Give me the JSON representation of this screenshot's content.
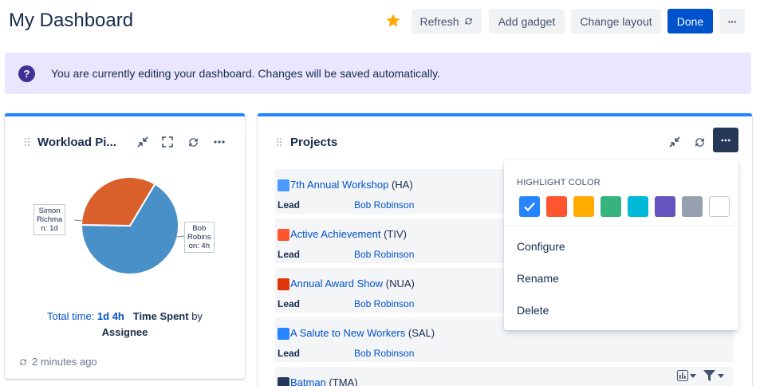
{
  "header": {
    "title": "My Dashboard",
    "refresh_label": "Refresh",
    "add_gadget_label": "Add gadget",
    "change_layout_label": "Change layout",
    "done_label": "Done",
    "more_label": "···",
    "star_icon": "star-icon",
    "star_color": "#ffab00"
  },
  "banner": {
    "text": "You are currently editing your dashboard. Changes will be saved automatically.",
    "icon": "question-icon"
  },
  "workload": {
    "title": "Workload Pi...",
    "chart_data": {
      "type": "pie",
      "slices": [
        {
          "label": "Simon Richman: 1d",
          "value": 1,
          "color": "#4a90c8"
        },
        {
          "label": "Bob Robinson: 4h",
          "value": 0.5,
          "color": "#d95f2b"
        }
      ]
    },
    "label_simon": [
      "Simon",
      "Richma",
      "n: 1d"
    ],
    "label_bob": [
      "Bob",
      "Robins",
      "on: 4h"
    ],
    "total_label": "Total time:",
    "total_value": "1d 4h",
    "time_spent": "Time Spent",
    "by": "by",
    "assignee": "Assignee",
    "updated": "2 minutes ago"
  },
  "projects": {
    "title": "Projects",
    "lead_label": "Lead",
    "rows": [
      {
        "name": "7th Annual Workshop",
        "key": "(HA)",
        "lead": "Bob Robinson",
        "icon_color": "#4c9aff"
      },
      {
        "name": "Active Achievement",
        "key": "(TIV)",
        "lead": "Bob Robinson",
        "icon_color": "#ff5630"
      },
      {
        "name": "Annual Award Show",
        "key": "(NUA)",
        "lead": "Bob Robinson",
        "icon_color": "#de350b"
      },
      {
        "name": "A Salute to New Workers",
        "key": "(SAL)",
        "lead": "Bob Robinson",
        "icon_color": "#2684ff"
      },
      {
        "name": "Batman",
        "key": "(TMA)",
        "lead": "",
        "icon_color": "#253858"
      }
    ]
  },
  "dropdown": {
    "heading": "HIGHLIGHT COLOR",
    "colors": [
      "#2684ff",
      "#ff5630",
      "#ffab00",
      "#36b37e",
      "#00b8d9",
      "#6554c0",
      "#97a0af",
      "#ffffff"
    ],
    "selected_index": 0,
    "items": [
      "Configure",
      "Rename",
      "Delete"
    ]
  }
}
